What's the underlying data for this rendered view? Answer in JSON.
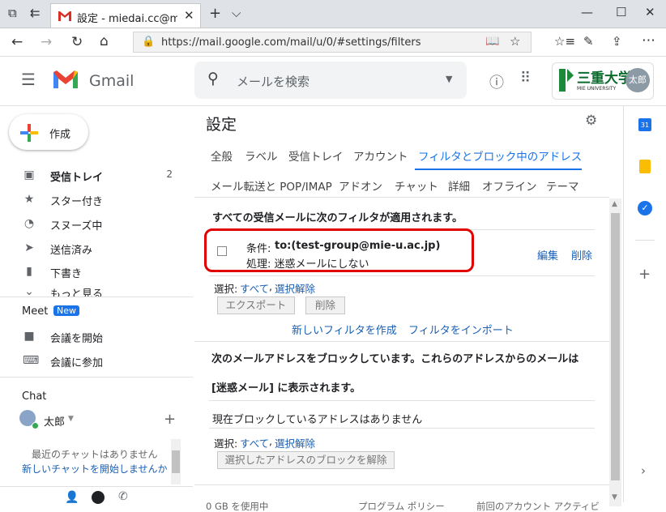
{
  "browser": {
    "tab_title": "設定 - miedai.cc@mie-u",
    "url": "https://mail.google.com/mail/u/0/#settings/filters",
    "new_tab": "+"
  },
  "header": {
    "app_name": "Gmail",
    "search_placeholder": "メールを検索",
    "org_logo_text": "三重大学",
    "org_logo_sub": "MIE UNIVERSITY",
    "avatar_text": "太郎"
  },
  "sidebar": {
    "compose": "作成",
    "items": [
      {
        "label": "受信トレイ",
        "count": "2"
      },
      {
        "label": "スター付き",
        "count": ""
      },
      {
        "label": "スヌーズ中",
        "count": ""
      },
      {
        "label": "送信済み",
        "count": ""
      },
      {
        "label": "下書き",
        "count": ""
      },
      {
        "label": "もっと見る",
        "count": ""
      }
    ],
    "meet_title": "Meet",
    "meet_badge": "New",
    "meet_items": [
      "会議を開始",
      "会議に参加"
    ],
    "chat_title": "Chat",
    "chat_user": "太郎",
    "chat_empty": "最近のチャットはありません",
    "chat_new": "新しいチャットを開始しませんか"
  },
  "main": {
    "title": "設定",
    "tabs_row1": [
      "全般",
      "ラベル",
      "受信トレイ",
      "アカウント",
      "フィルタとブロック中のアドレス"
    ],
    "tabs_row2": [
      "メール転送と POP/IMAP",
      "アドオン",
      "チャット",
      "詳細",
      "オフライン",
      "テーマ"
    ],
    "filters_heading": "すべての受信メールに次のフィルタが適用されます。",
    "filter": {
      "cond_label": "条件: ",
      "cond_value": "to:(test-group@mie-u.ac.jp)",
      "action": "処理: 迷惑メールにしない",
      "edit": "編集",
      "delete": "削除"
    },
    "select_label": "選択: ",
    "select_all": "すべて",
    "select_none": "選択解除",
    "export_btn": "エクスポート",
    "delete_btn": "削除",
    "new_filter": "新しいフィルタを作成",
    "import_filter": "フィルタをインポート",
    "blocked_heading1": "次のメールアドレスをブロックしています。これらのアドレスからのメールは",
    "blocked_heading2": "[迷惑メール] に表示されます。",
    "blocked_none": "現在ブロックしているアドレスはありません",
    "unblock_btn": "選択したアドレスのブロックを解除",
    "footer_storage": "0 GB を使用中",
    "footer_policy": "プログラム ポリシー",
    "footer_activity": "前回のアカウント アクティビ"
  },
  "colors": {
    "accent": "#1a73e8",
    "highlight": "#e00000"
  }
}
